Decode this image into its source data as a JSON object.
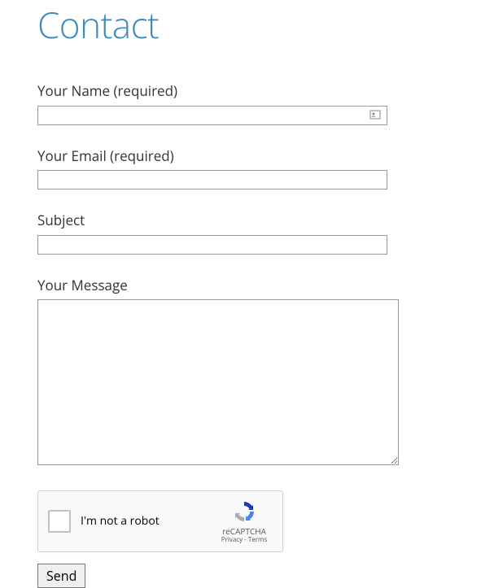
{
  "title": "Contact",
  "form": {
    "name_label": "Your Name (required)",
    "name_value": "",
    "email_label": "Your Email (required)",
    "email_value": "",
    "subject_label": "Subject",
    "subject_value": "",
    "message_label": "Your Message",
    "message_value": ""
  },
  "recaptcha": {
    "label": "I'm not a robot",
    "brand": "reCAPTCHA",
    "terms": "Privacy - Terms"
  },
  "submit_label": "Send"
}
